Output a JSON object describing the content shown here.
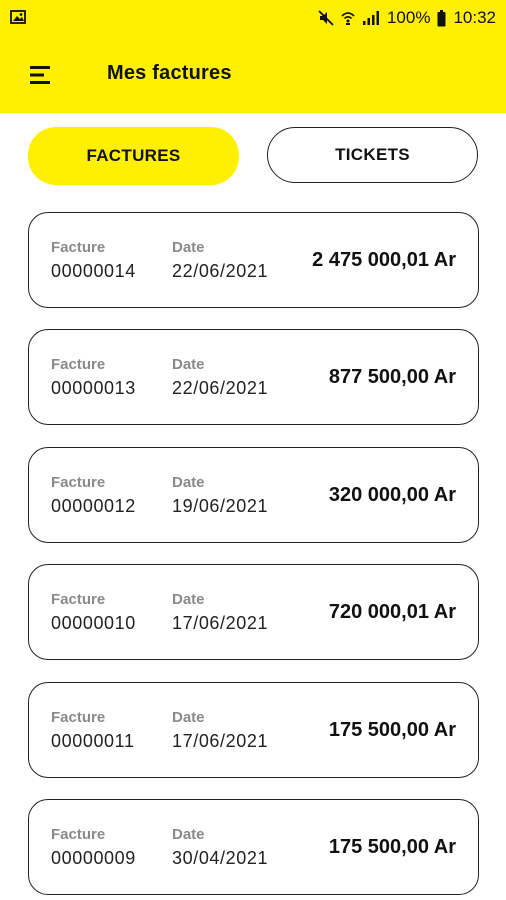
{
  "status_bar": {
    "battery_text": "100%",
    "time": "10:32",
    "icons": [
      "image-icon",
      "mute-icon",
      "wifi-icon",
      "signal-icon",
      "battery-icon"
    ]
  },
  "header": {
    "title": "Mes factures",
    "menu_icon": "menu-icon",
    "background": "#ffef00"
  },
  "tabs": [
    {
      "label": "FACTURES",
      "active": true
    },
    {
      "label": "TICKETS",
      "active": false
    }
  ],
  "invoices": {
    "facture_label": "Facture",
    "date_label": "Date",
    "items": [
      {
        "number": "00000014",
        "date": "22/06/2021",
        "amount": "2 475 000,01 Ar"
      },
      {
        "number": "00000013",
        "date": "22/06/2021",
        "amount": "877 500,00 Ar"
      },
      {
        "number": "00000012",
        "date": "19/06/2021",
        "amount": "320 000,00 Ar"
      },
      {
        "number": "00000010",
        "date": "17/06/2021",
        "amount": "720 000,01 Ar"
      },
      {
        "number": "00000011",
        "date": "17/06/2021",
        "amount": "175 500,00 Ar"
      },
      {
        "number": "00000009",
        "date": "30/04/2021",
        "amount": "175 500,00 Ar"
      }
    ]
  }
}
